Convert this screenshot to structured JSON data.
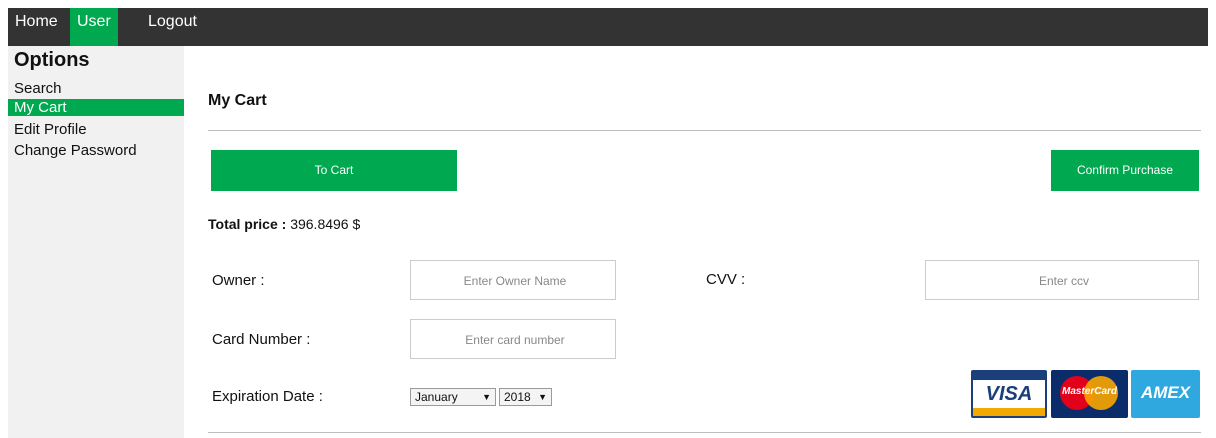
{
  "nav": {
    "items": [
      "Home",
      "User",
      "Logout"
    ],
    "active": "User"
  },
  "sidebar": {
    "title": "Options",
    "items": [
      "Search",
      "My Cart",
      "Edit Profile",
      "Change Password"
    ],
    "active": "My Cart"
  },
  "main": {
    "title": "My Cart",
    "to_cart_label": "To Cart",
    "confirm_label": "Confirm Purchase",
    "total_label": "Total price :",
    "total_value": "396.8496 $"
  },
  "form": {
    "owner_label": "Owner :",
    "owner_placeholder": "Enter Owner Name",
    "cvv_label": "CVV :",
    "cvv_placeholder": "Enter ccv",
    "card_label": "Card Number :",
    "card_placeholder": "Enter card number",
    "exp_label": "Expiration Date :",
    "month_value": "January",
    "year_value": "2018"
  },
  "cards": {
    "visa": "VISA",
    "mastercard": "MasterCard",
    "amex": "AMEX"
  },
  "colors": {
    "accent": "#00a94f",
    "topbar": "#333333",
    "sidebar": "#f1f1f1"
  }
}
